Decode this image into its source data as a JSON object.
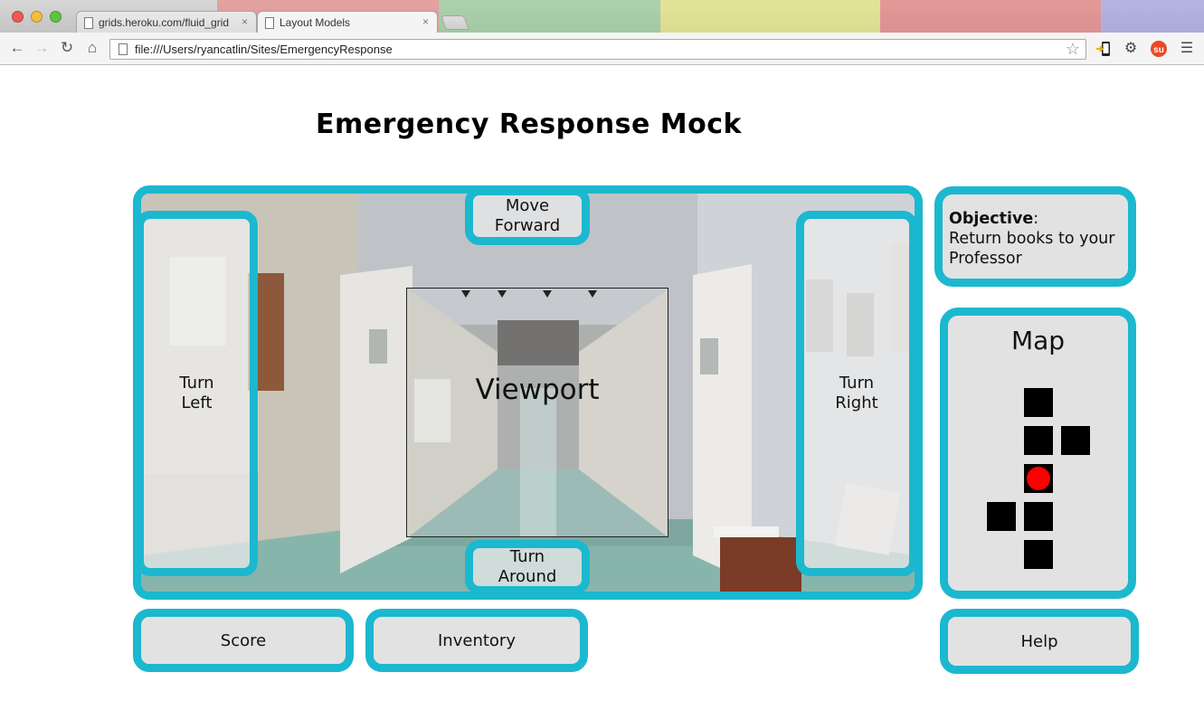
{
  "browser": {
    "tabs": [
      {
        "label": "grids.heroku.com/fluid_grid",
        "active": false
      },
      {
        "label": "Layout Models",
        "active": true
      }
    ],
    "tab_close_glyph": "×",
    "address": "file:///Users/ryancatlin/Sites/EmergencyResponse",
    "nav_icons": [
      "back-icon",
      "forward-icon",
      "reload-icon",
      "home-icon"
    ],
    "toolbar_icons": [
      "bookmark-star-icon",
      "phone-extension-icon",
      "settings-gear-icon",
      "stumbleupon-icon",
      "menu-icon"
    ]
  },
  "page": {
    "title": "Emergency Response Mock"
  },
  "game": {
    "move_forward": [
      "Move",
      "Forward"
    ],
    "turn_left": [
      "Turn",
      "Left"
    ],
    "turn_right": [
      "Turn",
      "Right"
    ],
    "turn_around": [
      "Turn",
      "Around"
    ],
    "viewport_label": "Viewport"
  },
  "objective": {
    "label": "Objective",
    "separator": ":",
    "text": "Return books to your Professor"
  },
  "map": {
    "title": "Map",
    "player_cell": "row 3, column 2"
  },
  "bottom": {
    "score": "Score",
    "inventory": "Inventory",
    "help": "Help"
  },
  "colors": {
    "accent": "#1bb8cf",
    "panel": "#e2e2e2",
    "player": "#ff0000",
    "map_cell": "#000000"
  }
}
